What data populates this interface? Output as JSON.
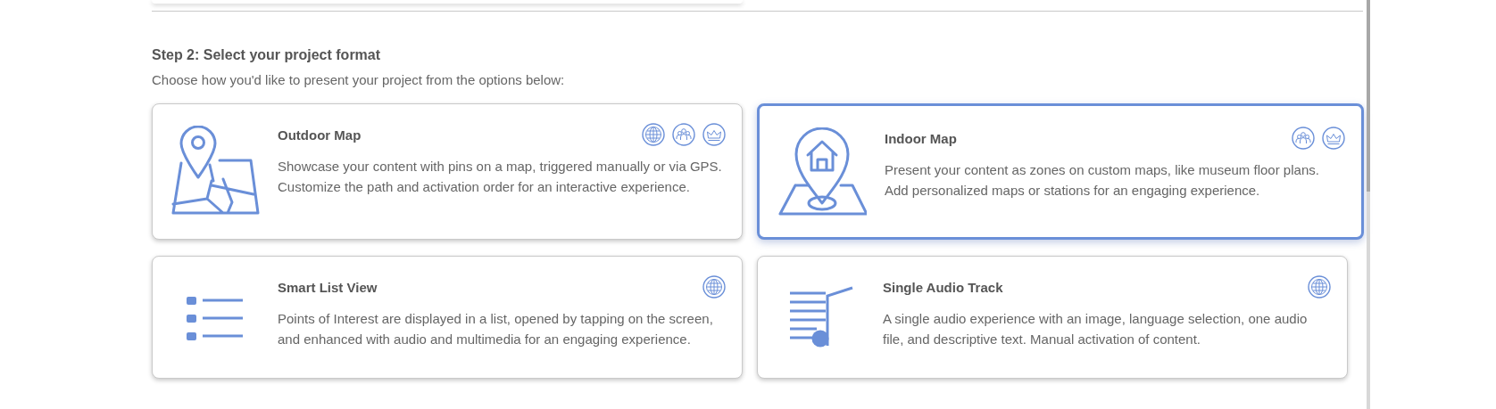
{
  "step": {
    "heading": "Step 2: Select your project format",
    "subtitle": "Choose how you'd like to present your project from the options below:"
  },
  "formats": [
    {
      "kind": "outdoor",
      "title": "Outdoor Map",
      "description": "Showcase your content with pins on a map, triggered manually or via GPS. Customize the path and activation order for an interactive experience.",
      "badges": [
        {
          "kind": "globe"
        },
        {
          "kind": "people"
        },
        {
          "kind": "crown"
        }
      ],
      "selected": false
    },
    {
      "kind": "indoor",
      "title": "Indoor Map",
      "description": "Present your content as zones on custom maps, like museum floor plans. Add personalized maps or stations for an engaging experience.",
      "badges": [
        {
          "kind": "people"
        },
        {
          "kind": "crown"
        }
      ],
      "selected": true
    },
    {
      "kind": "list",
      "title": "Smart List View",
      "description": "Points of Interest are displayed in a list, opened by tapping on the screen, and enhanced with audio and multimedia for an engaging experience.",
      "badges": [
        {
          "kind": "globe"
        }
      ],
      "selected": false
    },
    {
      "kind": "audio",
      "title": "Single Audio Track",
      "description": "A single audio experience with an image, language selection, one audio file, and descriptive text. Manual activation of content.",
      "badges": [
        {
          "kind": "globe"
        }
      ],
      "selected": false
    }
  ]
}
